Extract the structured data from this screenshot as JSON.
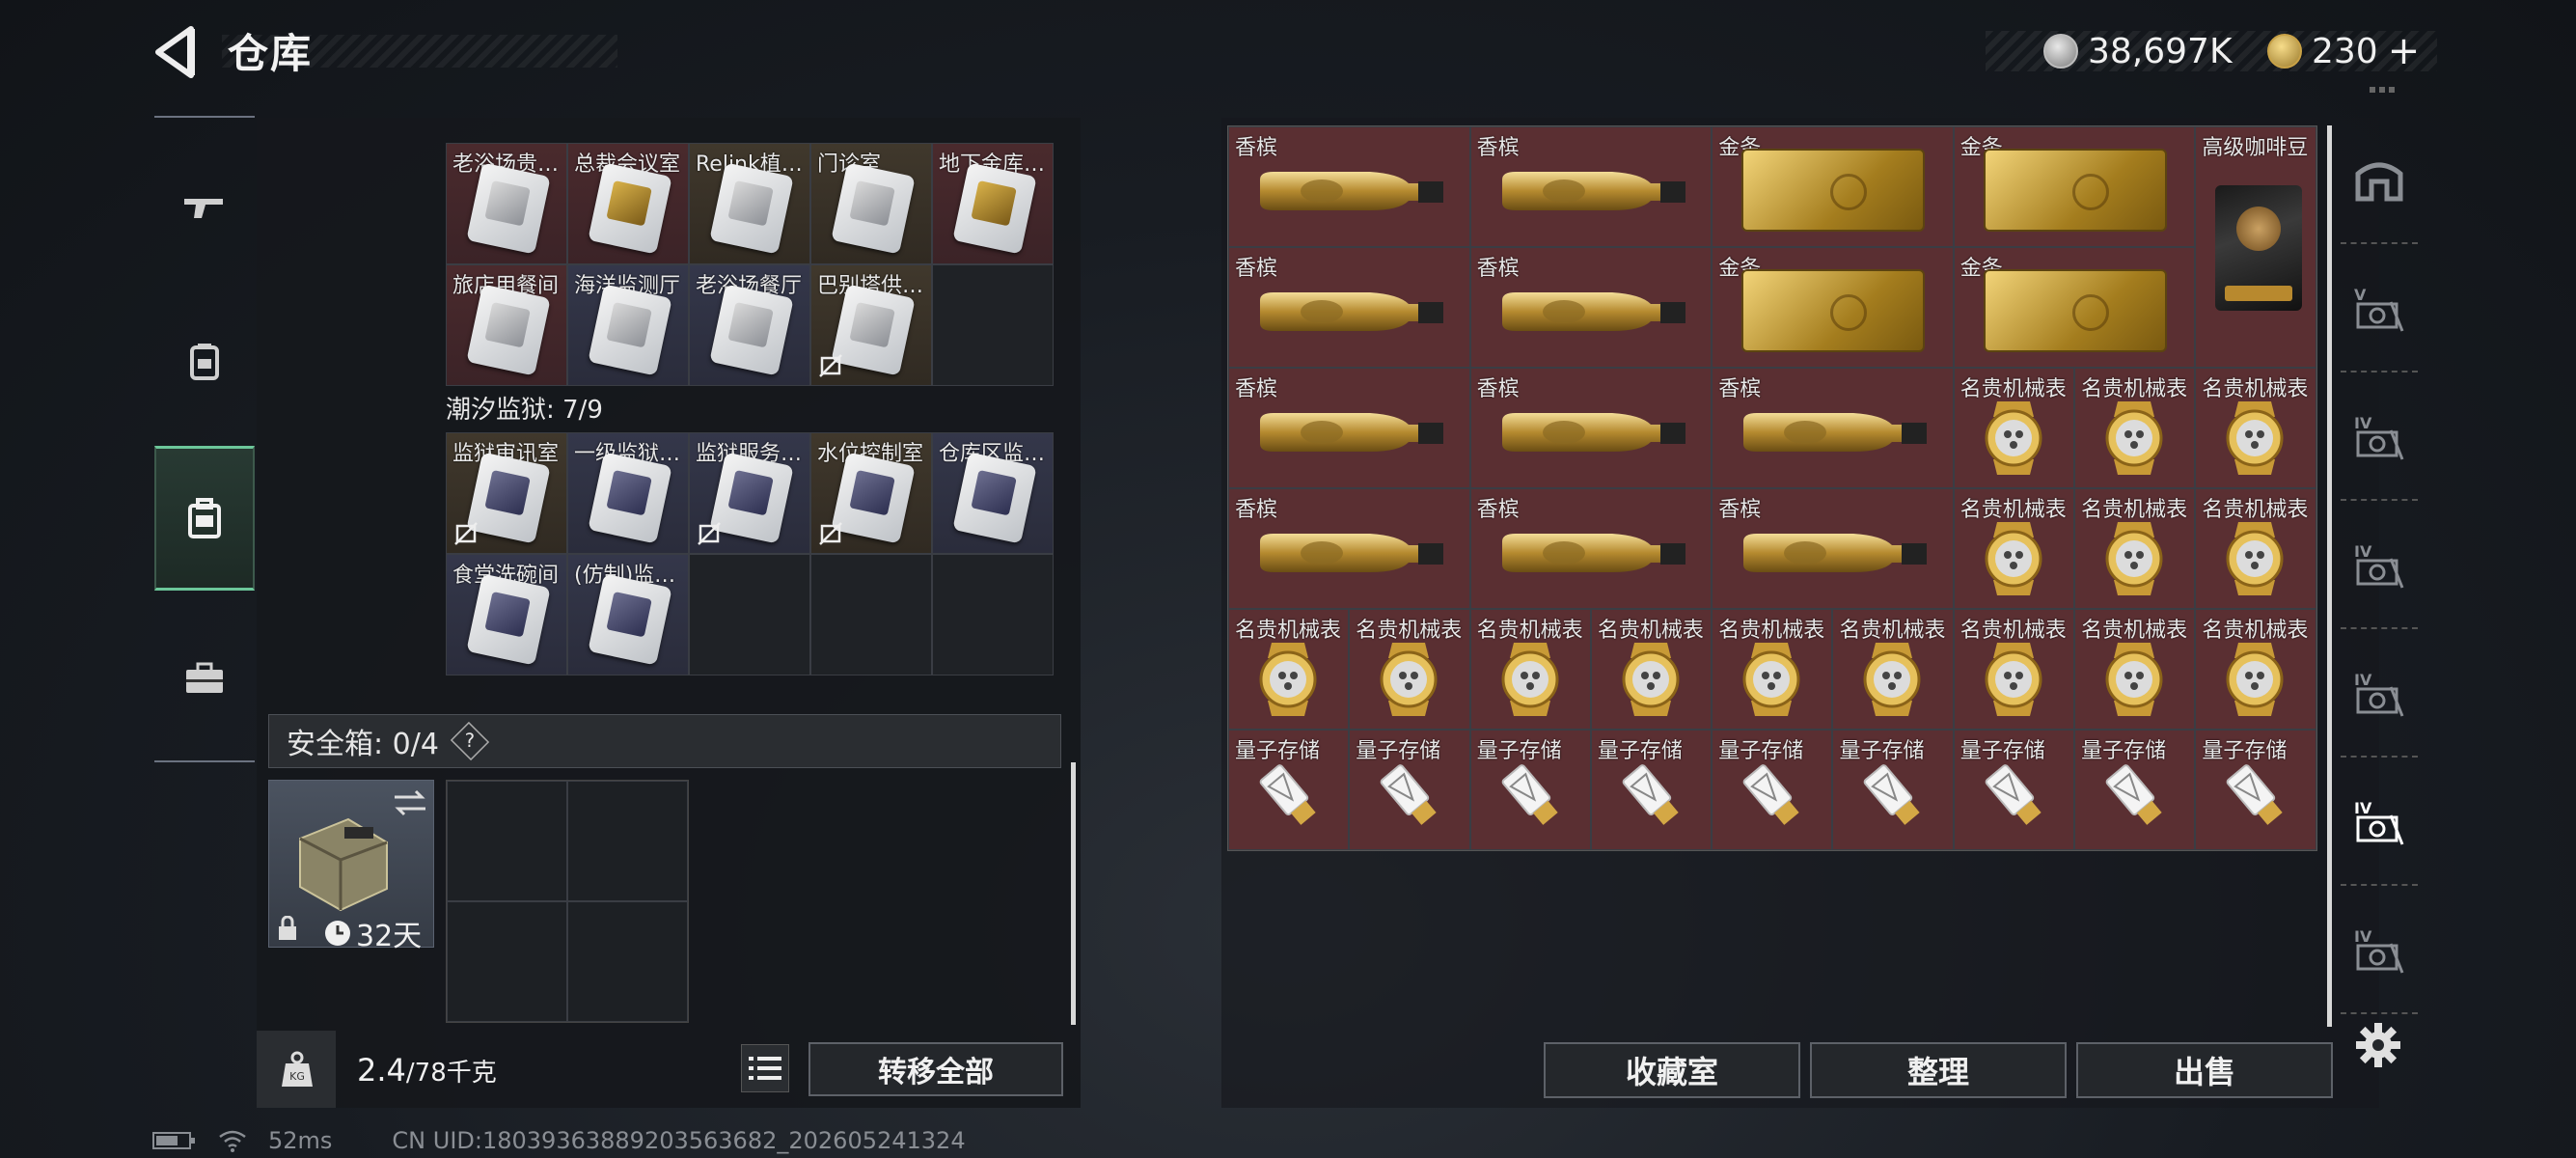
{
  "header": {
    "title": "仓库",
    "currency": [
      {
        "name": "silver-coin",
        "value": "38,697K"
      },
      {
        "name": "gold-coin",
        "value": "230"
      }
    ],
    "add_symbol": "+"
  },
  "left_categories": [
    {
      "name": "weapons",
      "icon": "gun-icon"
    },
    {
      "name": "equipment",
      "icon": "backpack-gear-icon"
    },
    {
      "name": "backpack",
      "icon": "bag-icon",
      "selected": true
    },
    {
      "name": "toolbox",
      "icon": "briefcase-icon"
    }
  ],
  "keycards_section_a": {
    "items": [
      {
        "label": "老浴场贵…",
        "bg": "red",
        "tone": "w"
      },
      {
        "label": "总裁会议室",
        "bg": "red",
        "tone": "g"
      },
      {
        "label": "Relink植…",
        "bg": "gold",
        "tone": "w"
      },
      {
        "label": "门诊室",
        "bg": "gold",
        "tone": "w"
      },
      {
        "label": "地下金库…",
        "bg": "red",
        "tone": "g"
      },
      {
        "label": "旅店用餐间",
        "bg": "red",
        "tone": "w"
      },
      {
        "label": "海洋监测厅",
        "bg": "blue",
        "tone": "w"
      },
      {
        "label": "老浴场餐厅",
        "bg": "blue",
        "tone": "w"
      },
      {
        "label": "巴别塔供…",
        "bg": "gold",
        "tone": "w",
        "locked": true
      }
    ]
  },
  "keycards_section_b": {
    "title": "潮汐监狱: 7/9",
    "items": [
      {
        "label": "监狱审讯室",
        "bg": "gold",
        "tone": "b",
        "locked": true
      },
      {
        "label": "一级监狱…",
        "bg": "blue",
        "tone": "b"
      },
      {
        "label": "监狱服务…",
        "bg": "blue",
        "tone": "b",
        "locked": true
      },
      {
        "label": "水位控制室",
        "bg": "gold",
        "tone": "b",
        "locked": true
      },
      {
        "label": "仓库区监…",
        "bg": "blue",
        "tone": "b"
      },
      {
        "label": "食堂洗碗间",
        "bg": "blue",
        "tone": "b"
      },
      {
        "label": "(仿制)监…",
        "bg": "blue",
        "tone": "b"
      }
    ]
  },
  "safe_box": {
    "title": "安全箱: 0/4",
    "help": "?",
    "duration": "32天"
  },
  "weight": {
    "current": "2.4",
    "max": "/78千克"
  },
  "buttons": {
    "transfer_all": "转移全部",
    "collection": "收藏室",
    "organize": "整理",
    "sell": "出售"
  },
  "status": {
    "ping": "52ms",
    "uid": "CN UID:1803936388920356368​2_202605241324"
  },
  "stash_items": [
    {
      "label": "香槟",
      "type": "bottle",
      "col": 1,
      "row": 1
    },
    {
      "label": "香槟",
      "type": "bottle",
      "col": 3,
      "row": 1
    },
    {
      "label": "金条",
      "type": "bar",
      "col": 5,
      "row": 1
    },
    {
      "label": "金条",
      "type": "bar",
      "col": 7,
      "row": 1
    },
    {
      "label": "高级咖啡豆",
      "type": "coffee",
      "col": 9,
      "row": 1
    },
    {
      "label": "香槟",
      "type": "bottle",
      "col": 1,
      "row": 2
    },
    {
      "label": "香槟",
      "type": "bottle",
      "col": 3,
      "row": 2
    },
    {
      "label": "金条",
      "type": "bar",
      "col": 5,
      "row": 2
    },
    {
      "label": "金条",
      "type": "bar",
      "col": 7,
      "row": 2
    },
    {
      "label": "香槟",
      "type": "bottle",
      "col": 1,
      "row": 3
    },
    {
      "label": "香槟",
      "type": "bottle",
      "col": 3,
      "row": 3
    },
    {
      "label": "香槟",
      "type": "bottle",
      "col": 5,
      "row": 3
    },
    {
      "label": "名贵机械表",
      "type": "watch",
      "col": 7,
      "row": 3
    },
    {
      "label": "名贵机械表",
      "type": "watch",
      "col": 8,
      "row": 3
    },
    {
      "label": "名贵机械表",
      "type": "watch",
      "col": 9,
      "row": 3
    },
    {
      "label": "香槟",
      "type": "bottle",
      "col": 1,
      "row": 4
    },
    {
      "label": "香槟",
      "type": "bottle",
      "col": 3,
      "row": 4
    },
    {
      "label": "香槟",
      "type": "bottle",
      "col": 5,
      "row": 4
    },
    {
      "label": "名贵机械表",
      "type": "watch",
      "col": 7,
      "row": 4
    },
    {
      "label": "名贵机械表",
      "type": "watch",
      "col": 8,
      "row": 4
    },
    {
      "label": "名贵机械表",
      "type": "watch",
      "col": 9,
      "row": 4
    },
    {
      "label": "名贵机械表",
      "type": "watch",
      "col": 1,
      "row": 5
    },
    {
      "label": "名贵机械表",
      "type": "watch",
      "col": 2,
      "row": 5
    },
    {
      "label": "名贵机械表",
      "type": "watch",
      "col": 3,
      "row": 5
    },
    {
      "label": "名贵机械表",
      "type": "watch",
      "col": 4,
      "row": 5
    },
    {
      "label": "名贵机械表",
      "type": "watch",
      "col": 5,
      "row": 5
    },
    {
      "label": "名贵机械表",
      "type": "watch",
      "col": 6,
      "row": 5
    },
    {
      "label": "名贵机械表",
      "type": "watch",
      "col": 7,
      "row": 5
    },
    {
      "label": "名贵机械表",
      "type": "watch",
      "col": 8,
      "row": 5
    },
    {
      "label": "名贵机械表",
      "type": "watch",
      "col": 9,
      "row": 5
    },
    {
      "label": "量子存储",
      "type": "usb",
      "col": 1,
      "row": 6
    },
    {
      "label": "量子存储",
      "type": "usb",
      "col": 2,
      "row": 6
    },
    {
      "label": "量子存储",
      "type": "usb",
      "col": 3,
      "row": 6
    },
    {
      "label": "量子存储",
      "type": "usb",
      "col": 4,
      "row": 6
    },
    {
      "label": "量子存储",
      "type": "usb",
      "col": 5,
      "row": 6
    },
    {
      "label": "量子存储",
      "type": "usb",
      "col": 6,
      "row": 6
    },
    {
      "label": "量子存储",
      "type": "usb",
      "col": 7,
      "row": 6
    },
    {
      "label": "量子存储",
      "type": "usb",
      "col": 8,
      "row": 6
    },
    {
      "label": "量子存储",
      "type": "usb",
      "col": 9,
      "row": 6
    }
  ],
  "right_tabs": [
    {
      "icon": "stash-home-icon"
    },
    {
      "icon": "stash-tab-v-icon",
      "mark": "V"
    },
    {
      "icon": "stash-tab-iv-icon",
      "mark": "IV"
    },
    {
      "icon": "stash-tab-iv-icon",
      "mark": "IV"
    },
    {
      "icon": "stash-tab-iv-icon",
      "mark": "IV"
    },
    {
      "icon": "stash-tab-iv-icon",
      "mark": "IV",
      "selected": true
    },
    {
      "icon": "stash-tab-iv-icon",
      "mark": "IV"
    }
  ],
  "colors": {
    "accent": "#6cc79a",
    "cell_wine": "#5a2f32"
  }
}
